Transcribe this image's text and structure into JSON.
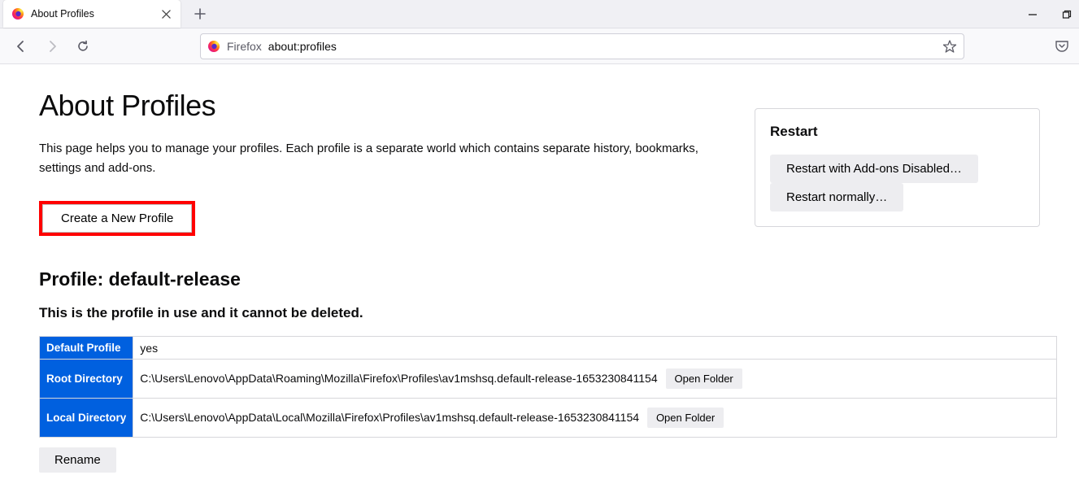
{
  "tab": {
    "title": "About Profiles"
  },
  "urlbar": {
    "identity_label": "Firefox",
    "url": "about:profiles"
  },
  "page": {
    "heading": "About Profiles",
    "subtitle": "This page helps you to manage your profiles. Each profile is a separate world which contains separate history, bookmarks, settings and add-ons.",
    "create_button": "Create a New Profile",
    "profile_heading": "Profile: default-release",
    "in_use_text": "This is the profile in use and it cannot be deleted.",
    "table": {
      "rows": [
        {
          "label": "Default Profile",
          "value": "yes",
          "button": null
        },
        {
          "label": "Root Directory",
          "value": "C:\\Users\\Lenovo\\AppData\\Roaming\\Mozilla\\Firefox\\Profiles\\av1mshsq.default-release-1653230841154",
          "button": "Open Folder"
        },
        {
          "label": "Local Directory",
          "value": "C:\\Users\\Lenovo\\AppData\\Local\\Mozilla\\Firefox\\Profiles\\av1mshsq.default-release-1653230841154",
          "button": "Open Folder"
        }
      ]
    },
    "rename_button": "Rename"
  },
  "restart": {
    "title": "Restart",
    "btn_addons": "Restart with Add-ons Disabled…",
    "btn_normal": "Restart normally…"
  }
}
